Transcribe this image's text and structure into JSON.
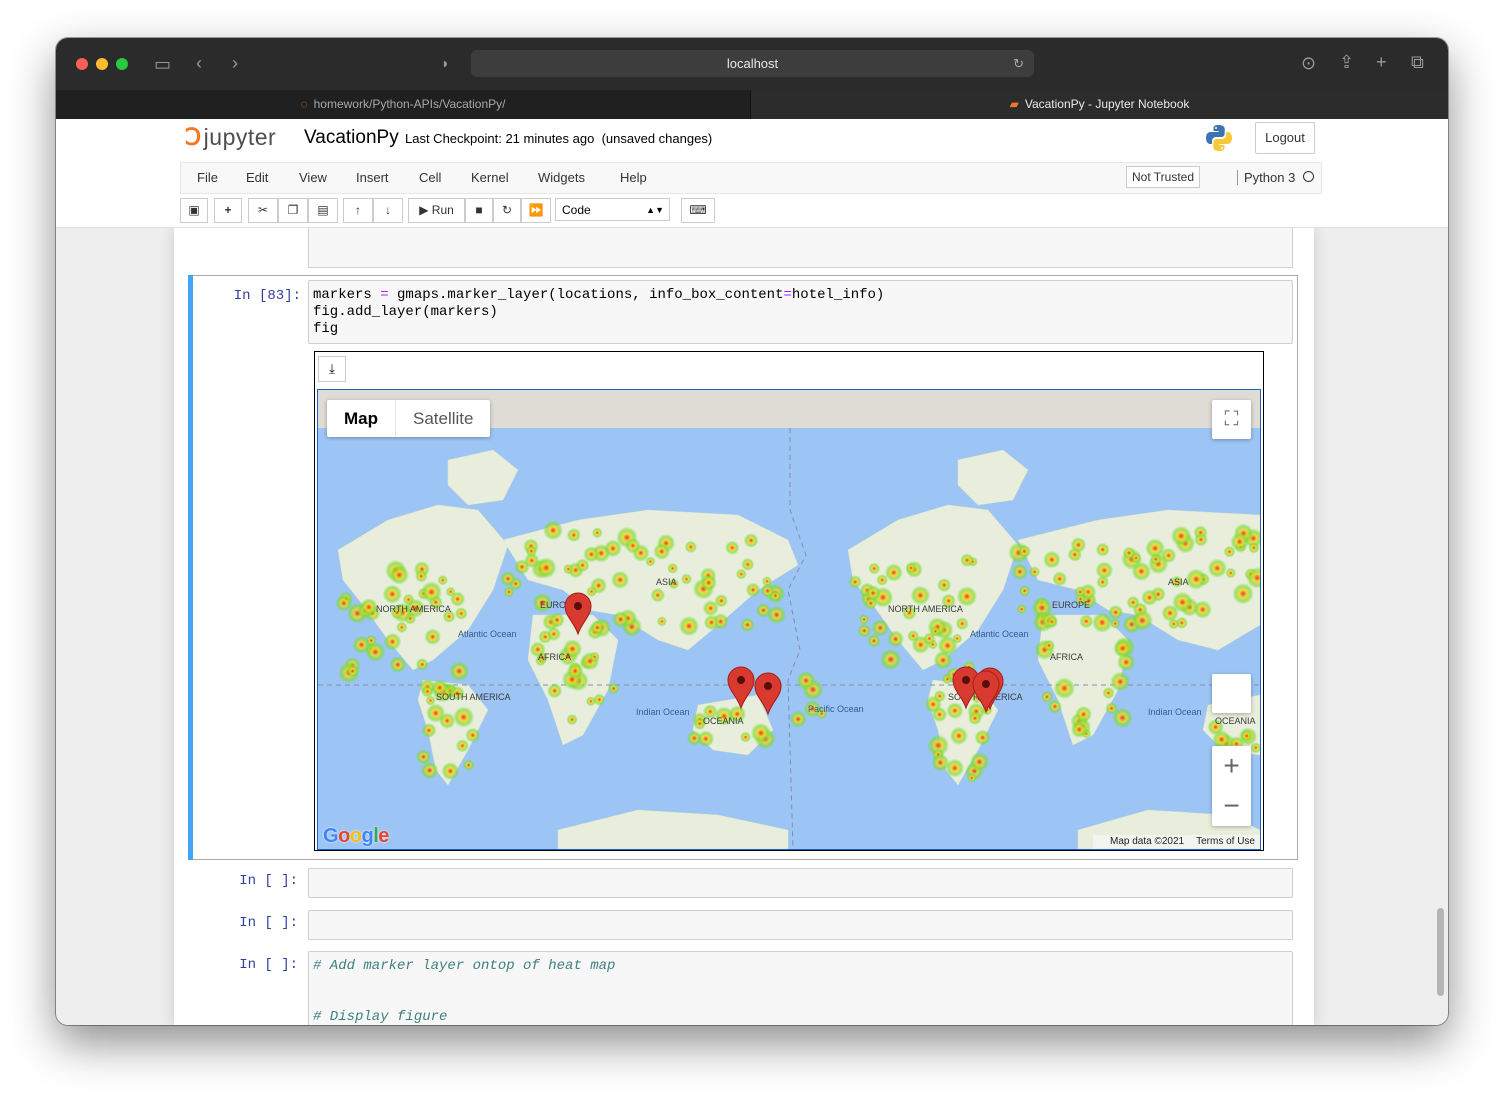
{
  "browser": {
    "url": "localhost",
    "tabs": [
      {
        "label": "homework/Python-APIs/VacationPy/",
        "active": false
      },
      {
        "label": "VacationPy - Jupyter Notebook",
        "active": true
      }
    ]
  },
  "jupyter": {
    "logo_text": "jupyter",
    "notebook_name": "VacationPy",
    "checkpoint": "Last Checkpoint: 21 minutes ago",
    "unsaved": "(unsaved changes)",
    "logout": "Logout"
  },
  "menu": {
    "items": [
      "File",
      "Edit",
      "View",
      "Insert",
      "Cell",
      "Kernel",
      "Widgets",
      "Help"
    ],
    "trusted": "Not Trusted",
    "kernel": "Python 3"
  },
  "toolbar": {
    "run_label": "Run",
    "cell_type": "Code"
  },
  "cells": {
    "active": {
      "prompt": "In [83]:",
      "line1_a": "markers ",
      "line1_op": "=",
      "line1_b": " gmaps.marker_layer(locations, info_box_content",
      "line1_op2": "=",
      "line1_c": "hotel_info)",
      "line2": "fig.add_layer(markers)",
      "line3": "fig"
    },
    "empty1_prompt": "In [ ]:",
    "empty2_prompt": "In [ ]:",
    "comment_cell": {
      "prompt": "In [ ]:",
      "comment1": "# Add marker layer ontop of heat map",
      "comment2": "# Display figure"
    }
  },
  "map": {
    "type_map": "Map",
    "type_satellite": "Satellite",
    "attribution": "Map data ©2021",
    "terms": "Terms of Use",
    "google": "Google",
    "labels": {
      "north_america": "NORTH AMERICA",
      "south_america": "SOUTH AMERICA",
      "europe": "EUROPE",
      "africa": "AFRICA",
      "asia": "ASIA",
      "oceania": "OCEANIA",
      "atlantic": "Atlantic Ocean",
      "indian": "Indian Ocean",
      "pacific": "Pacific Ocean"
    },
    "colors": {
      "water": "#9cc5f5",
      "land": "#e8eedb",
      "heat_low": "#7dd93b",
      "heat_mid": "#f0d928",
      "heat_high": "#e82c24",
      "marker": "#d93a30"
    }
  }
}
